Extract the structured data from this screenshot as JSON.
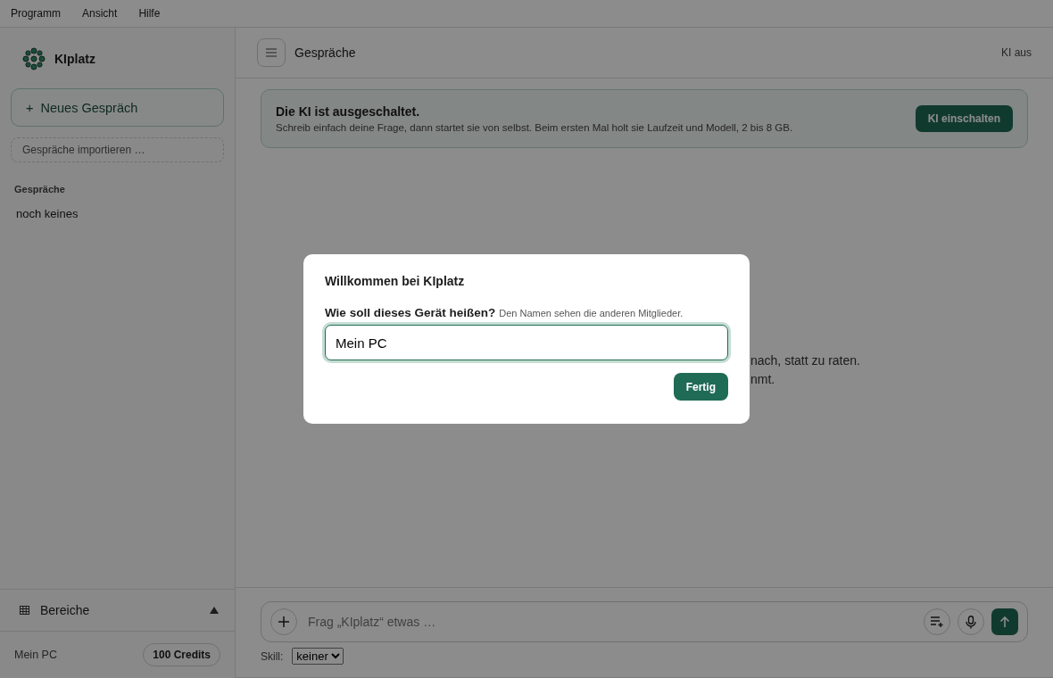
{
  "menu": [
    "Programm",
    "Ansicht",
    "Hilfe"
  ],
  "sidebar": {
    "app_name": "KIplatz",
    "new_button_icon": "+",
    "new_button": "Neues Gespräch",
    "import_button": "Gespräche importieren …",
    "section_title": "Gespräche",
    "empty_text": "noch keines",
    "areas": {
      "label": "Bereiche",
      "expanded": false
    },
    "device": "Mein PC",
    "credits": "100 Credits"
  },
  "header": {
    "title": "Gespräche",
    "status": "KI aus"
  },
  "banner": {
    "title": "Die KI ist ausgeschaltet.",
    "text": "Schreib einfach deine Frage, dann startet sie von selbst. Beim ersten Mal holt sie Laufzeit und Modell, 2 bis 8 GB.",
    "button": "KI einschalten"
  },
  "background_lines": [
    "nach, statt zu raten.",
    "nmt."
  ],
  "composer": {
    "placeholder": "Frag „KIplatz“ etwas …",
    "skill_label": "Skill:",
    "skill_value": "keiner"
  },
  "dialog": {
    "title": "Willkommen bei KIplatz",
    "question": "Wie soll dieses Gerät heißen?",
    "hint": "Den Namen sehen die anderen Mitglieder.",
    "value": "Mein PC",
    "button": "Fertig"
  }
}
